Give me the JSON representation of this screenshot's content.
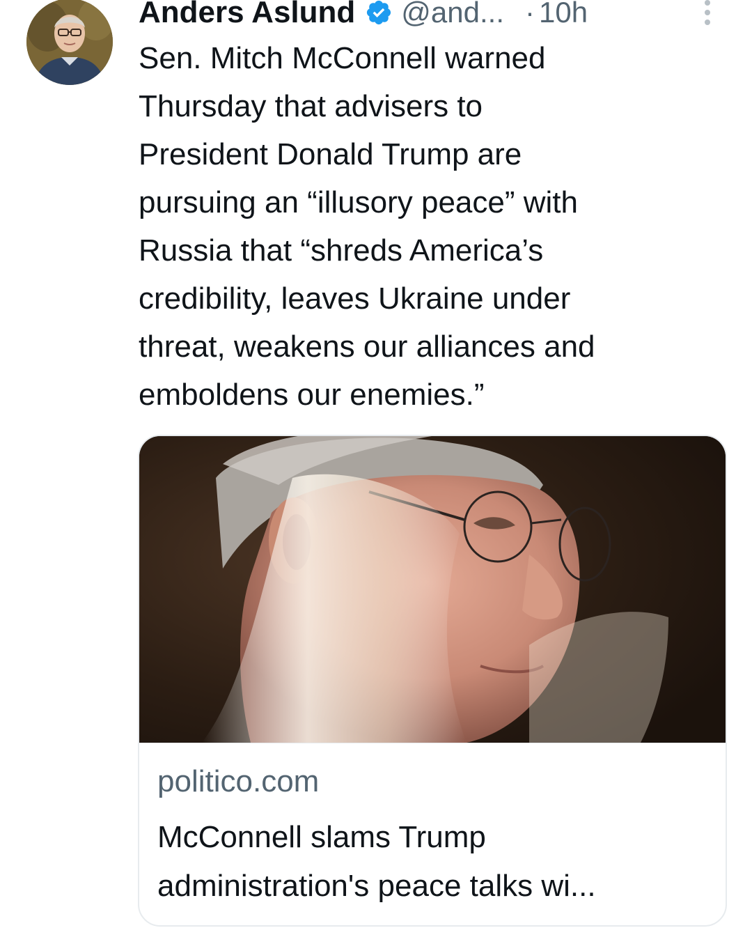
{
  "tweet": {
    "author_name": "Anders Aslund",
    "handle": "@and...",
    "separator": "·",
    "time": "10h",
    "verified": true,
    "verified_icon": "verified-badge-icon",
    "more_icon": "more-vertical-icon",
    "text": "Sen. Mitch McConnell warned\nThursday that advisers to\nPresident Donald Trump are\npursuing an “illusory peace” with\nRussia that “shreds America’s\ncredibility, leaves Ukraine under\nthreat, weakens our alliances and\nemboldens our enemies.”"
  },
  "link_card": {
    "domain": "politico.com",
    "title": "McConnell slams Trump\nadministration's peace talks wi..."
  },
  "colors": {
    "text_primary": "#0f1419",
    "text_secondary": "#536471",
    "verified_blue": "#1d9bf0",
    "card_border": "#e7ebee"
  }
}
